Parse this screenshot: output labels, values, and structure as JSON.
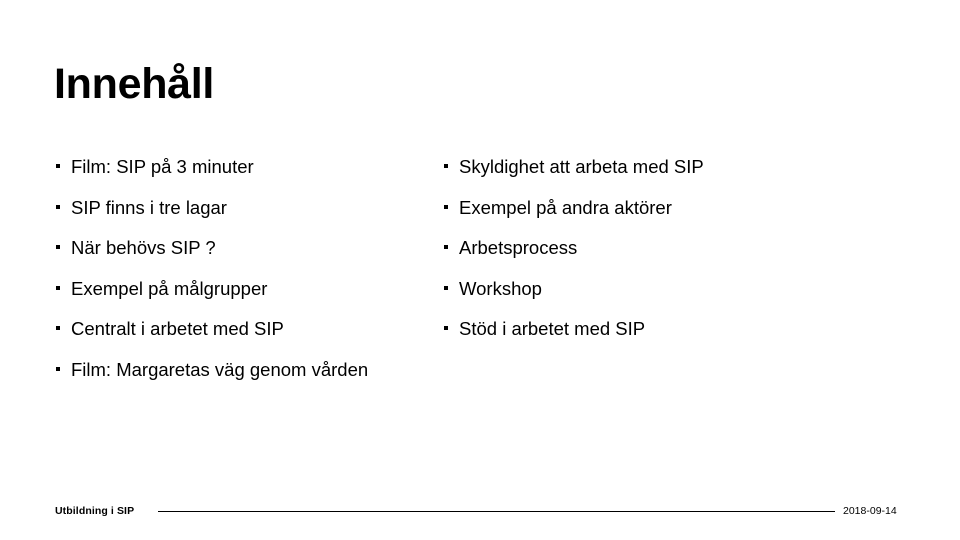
{
  "slide": {
    "title": "Innehåll",
    "background_color": "#ffffff",
    "text_color": "#000000"
  },
  "content": {
    "left_column": [
      {
        "text": "Film: SIP på 3 minuter"
      },
      {
        "text": "SIP finns i tre lagar"
      },
      {
        "text": "När behövs SIP ?"
      },
      {
        "text": "Exempel på målgrupper"
      },
      {
        "text": "Centralt i arbetet med SIP"
      },
      {
        "text": "Film: Margaretas väg genom vården"
      }
    ],
    "right_column": [
      {
        "text": "Skyldighet att arbeta med SIP"
      },
      {
        "text": "Exempel på andra aktörer"
      },
      {
        "text": "Arbetsprocess"
      },
      {
        "text": "Workshop"
      },
      {
        "text": "Stöd i arbetet med SIP"
      }
    ]
  },
  "footer": {
    "left_label": "Utbildning i SIP",
    "date": "2018-09-14"
  }
}
